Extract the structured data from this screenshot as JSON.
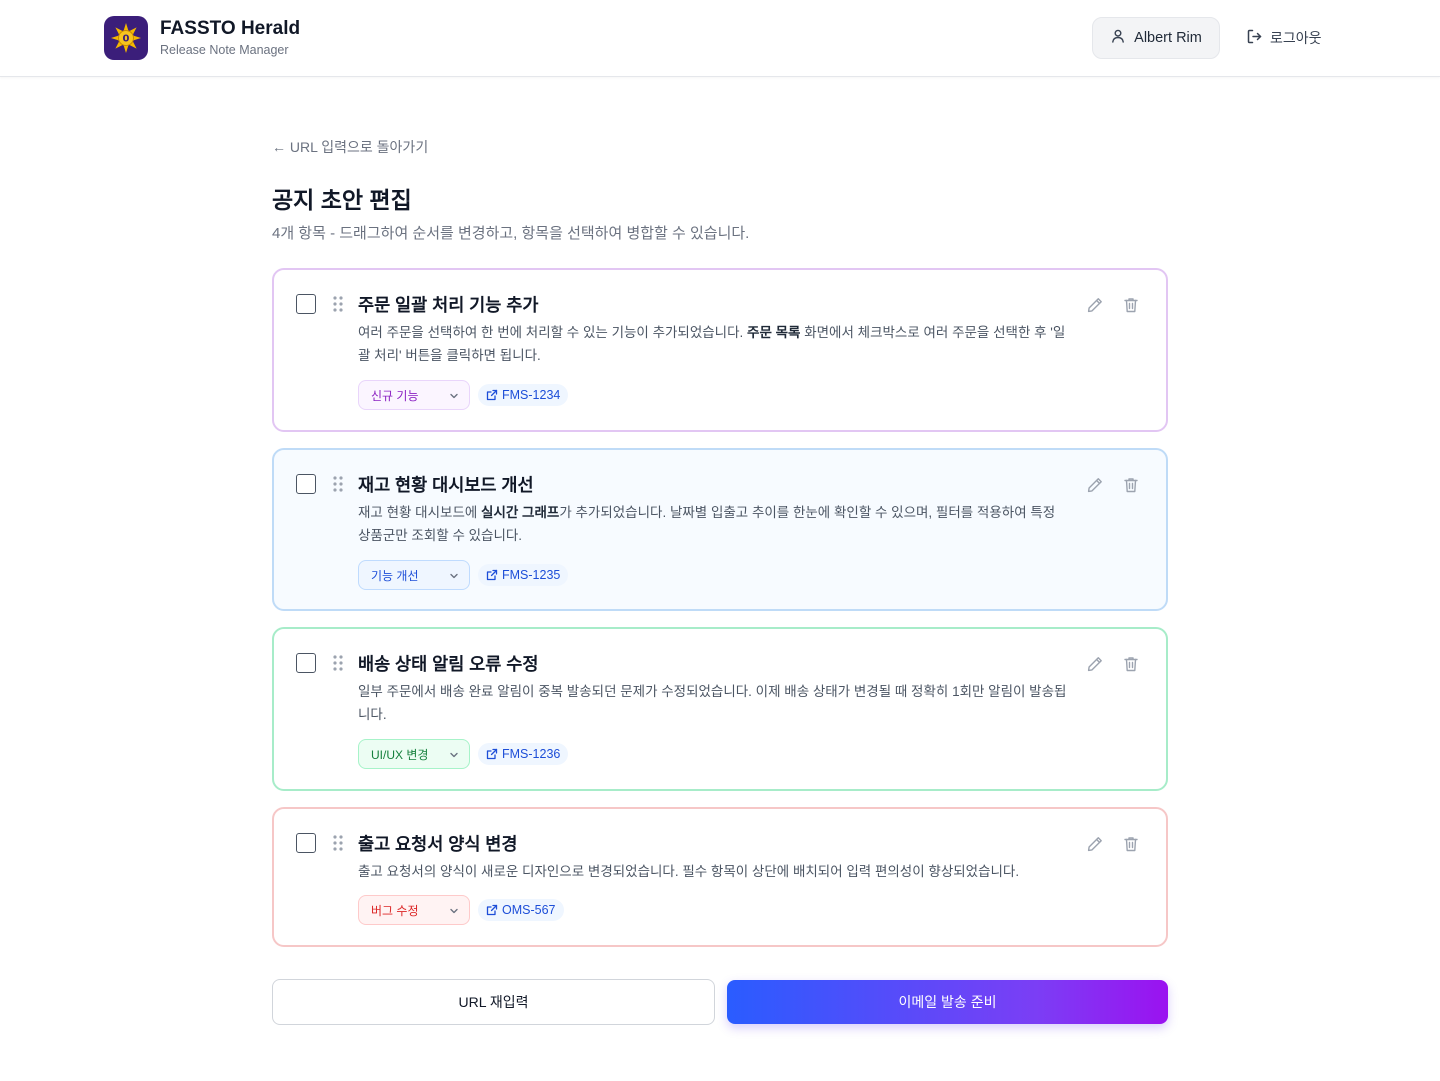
{
  "header": {
    "app_title": "FASSTO Herald",
    "app_subtitle": "Release Note Manager",
    "user_name": "Albert Rim",
    "logout_label": "로그아웃"
  },
  "page": {
    "back_label": "← URL 입력으로 돌아가기",
    "title": "공지 초안 편집",
    "description": "4개 항목 - 드래그하여 순서를 변경하고, 항목을 선택하여 병합할 수 있습니다."
  },
  "items": [
    {
      "title": "주문 일괄 처리 기능 추가",
      "body_parts": [
        "여러 주문을 선택하여 한 번에 처리할 수 있는 기능이 추가되었습니다. ",
        "주문 목록",
        " 화면에서 체크박스로 여러 주문을 선택한 후 '일괄 처리' 버튼을 클릭하면 됩니다."
      ],
      "category": "신규 기능",
      "ticket": "FMS-1234",
      "border_color": "#e2c6f3",
      "bg_color": "#ffffff",
      "cat_bg": "#fbf5ff",
      "cat_border": "#e9d5fb",
      "cat_color": "#8a1fc2"
    },
    {
      "title": "재고 현황 대시보드 개선",
      "body_parts": [
        "재고 현황 대시보드에 ",
        "실시간 그래프",
        "가 추가되었습니다. 날짜별 입출고 추이를 한눈에 확인할 수 있으며, 필터를 적용하여 특정 상품군만 조회할 수 있습니다."
      ],
      "category": "기능 개선",
      "ticket": "FMS-1235",
      "border_color": "#bfdbf7",
      "bg_color": "#f7fbff",
      "cat_bg": "#eff6ff",
      "cat_border": "#bfdbfe",
      "cat_color": "#1d4ed8"
    },
    {
      "title": "배송 상태 알림 오류 수정",
      "body_parts": [
        "일부 주문에서 배송 완료 알림이 중복 발송되던 문제가 수정되었습니다. 이제 배송 상태가 변경될 때 정확히 1회만 알림이 발송됩니다.",
        "",
        ""
      ],
      "category": "UI/UX 변경",
      "ticket": "FMS-1236",
      "border_color": "#a7ecc9",
      "bg_color": "#ffffff",
      "cat_bg": "#ecfdf3",
      "cat_border": "#a7f3c9",
      "cat_color": "#15803d"
    },
    {
      "title": "출고 요청서 양식 변경",
      "body_parts": [
        "출고 요청서의 양식이 새로운 디자인으로 변경되었습니다. 필수 항목이 상단에 배치되어 입력 편의성이 향상되었습니다.",
        "",
        ""
      ],
      "category": "버그 수정",
      "ticket": "OMS-567",
      "border_color": "#f6c7c7",
      "bg_color": "#ffffff",
      "cat_bg": "#fff3f3",
      "cat_border": "#fecaca",
      "cat_color": "#dc2626"
    }
  ],
  "actions": {
    "reenter_label": "URL 재입력",
    "prepare_email_label": "이메일 발송 준비"
  },
  "icons": {
    "user": "user-icon",
    "logout": "logout-icon",
    "drag": "drag-handle-icon",
    "edit": "pencil-icon",
    "delete": "trash-icon",
    "chevron": "chevron-down-icon",
    "external": "external-link-icon"
  }
}
